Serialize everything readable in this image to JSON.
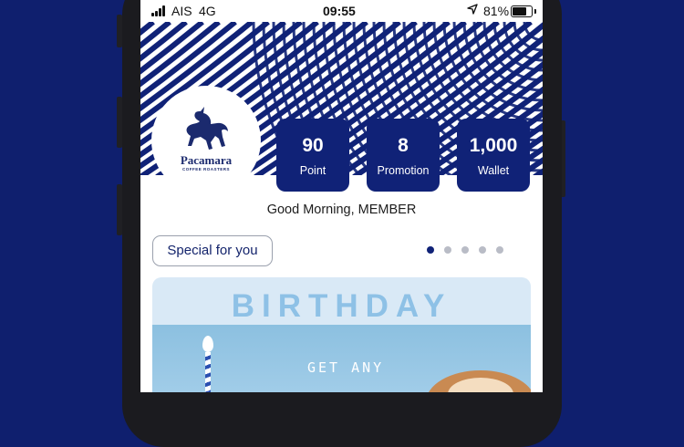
{
  "status_bar": {
    "carrier": "AIS",
    "network": "4G",
    "time": "09:55",
    "battery": "81%",
    "battery_level": 0.81
  },
  "brand": {
    "name": "Pacamara",
    "subtitle": "COFFEE ROASTERS"
  },
  "stats": [
    {
      "value": "90",
      "label": "Point"
    },
    {
      "value": "8",
      "label": "Promotion"
    },
    {
      "value": "1,000",
      "label": "Wallet"
    }
  ],
  "greeting": "Good Morning, MEMBER",
  "special_button": "Special for you",
  "carousel": {
    "count": 5,
    "active_index": 0
  },
  "promo": {
    "title": "BIRTHDAY SPECIAL",
    "subtitle": "GET ANY"
  },
  "colors": {
    "background": "#0f1f6e",
    "accent": "#102277",
    "promo_title": "#8ec1e6"
  }
}
